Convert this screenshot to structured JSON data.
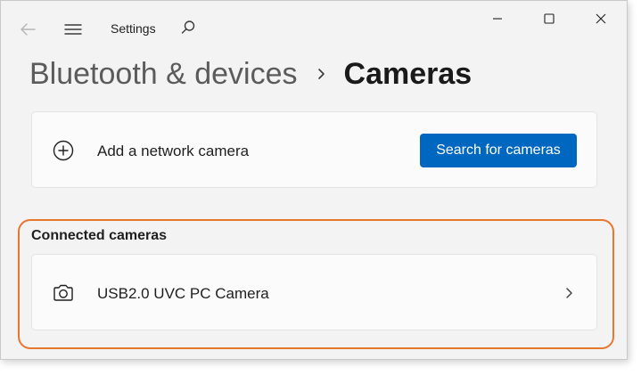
{
  "app": {
    "title": "Settings"
  },
  "titlebar": {
    "back_icon": "back-arrow-icon",
    "menu_icon": "hamburger-menu-icon",
    "search_icon": "search-icon",
    "controls": [
      "minimize-icon",
      "maximize-icon",
      "close-icon"
    ]
  },
  "breadcrumb": {
    "parent": "Bluetooth & devices",
    "current": "Cameras"
  },
  "add_camera": {
    "icon": "add-circle-icon",
    "label": "Add a network camera",
    "button_label": "Search for cameras"
  },
  "connected": {
    "title": "Connected cameras",
    "items": [
      {
        "icon": "camera-icon",
        "name": "USB2.0 UVC PC Camera"
      }
    ]
  },
  "colors": {
    "accent": "#0067c0",
    "highlight_outline": "#e8772e",
    "background": "#f3f3f3",
    "card": "#fbfbfb"
  }
}
